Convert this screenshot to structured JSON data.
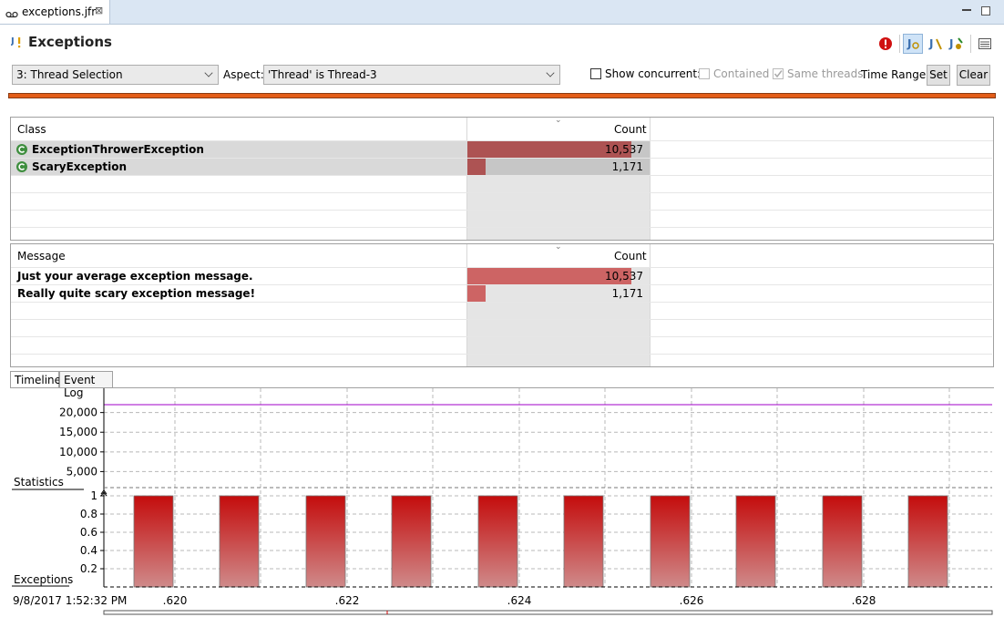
{
  "editor_tab": {
    "label": "exceptions.jfr",
    "close": "⊠"
  },
  "header": {
    "title": "Exceptions"
  },
  "toolbar": {
    "selection_value": "3: Thread Selection",
    "aspect_label": "Aspect:",
    "aspect_value": "'Thread' is Thread-3",
    "show_concurrent_label": "Show concurrent:",
    "contained_label": "Contained",
    "same_threads_label": "Same threads",
    "time_range_label": "Time Range:",
    "set_label": "Set",
    "clear_label": "Clear"
  },
  "class_table": {
    "col_class": "Class",
    "col_count": "Count",
    "rows": [
      {
        "name": "ExceptionThrowerException",
        "count": "10,537",
        "fraction": 0.9
      },
      {
        "name": "ScaryException",
        "count": "1,171",
        "fraction": 0.1
      }
    ]
  },
  "message_table": {
    "col_message": "Message",
    "col_count": "Count",
    "rows": [
      {
        "name": "Just your average exception message.",
        "count": "10,537",
        "fraction": 0.9
      },
      {
        "name": "Really quite scary exception message!",
        "count": "1,171",
        "fraction": 0.1
      }
    ]
  },
  "bottom_tabs": {
    "timeline": "Timeline",
    "event_log": "Event Log"
  },
  "chart": {
    "statistics_label": "Statistics",
    "exceptions_label": "Exceptions",
    "start_time": "9/8/2017 1:52:32 PM",
    "colors": {
      "line": "#a000c8",
      "bar_top": "#c40c0c",
      "bar_bottom": "#cf8a8a"
    }
  },
  "chart_data": [
    {
      "type": "line",
      "name_label": "Statistics",
      "yticks": [
        "20,000",
        "15,000",
        "10,000",
        "5,000"
      ],
      "ytick_values": [
        20000,
        15000,
        10000,
        5000
      ],
      "ylim": [
        0,
        22000
      ],
      "series": [
        {
          "values": [
            22000,
            22000
          ]
        }
      ]
    },
    {
      "type": "bar",
      "name_label": "Exceptions",
      "yticks": [
        "1",
        "0.8",
        "0.6",
        "0.4",
        "0.2"
      ],
      "ytick_values": [
        1,
        0.8,
        0.6,
        0.4,
        0.2
      ],
      "ylim": [
        0,
        1
      ],
      "x_ticks": [
        ".620",
        ".622",
        ".624",
        ".626",
        ".628"
      ],
      "values": [
        1,
        1,
        1,
        1,
        1,
        1,
        1,
        1,
        1,
        1
      ]
    }
  ]
}
